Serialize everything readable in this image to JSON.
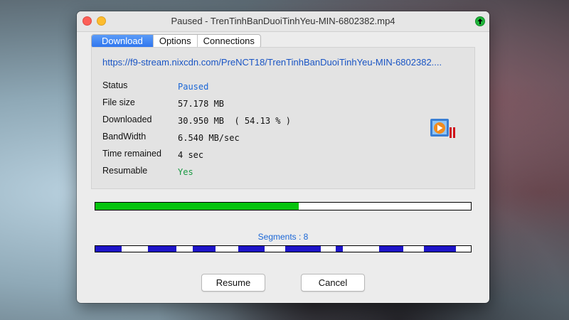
{
  "window": {
    "title": "Paused -  TrenTinhBanDuoiTinhYeu-MIN-6802382.mp4"
  },
  "tabs": [
    "Download",
    "Options",
    "Connections"
  ],
  "url": "https://f9-stream.nixcdn.com/PreNCT18/TrenTinhBanDuoiTinhYeu-MIN-6802382....",
  "info": {
    "status_label": "Status",
    "status_value": "Paused",
    "filesize_label": "File size",
    "filesize_value": "57.178 MB",
    "downloaded_label": "Downloaded",
    "downloaded_value": "30.950 MB  ( 54.13 % )",
    "bandwidth_label": "BandWidth",
    "bandwidth_value": "6.540 MB/sec",
    "time_label": "Time remained",
    "time_value": "4 sec",
    "resumable_label": "Resumable",
    "resumable_value": "Yes"
  },
  "progress": {
    "fraction": 0.5413,
    "color": "#06c40e"
  },
  "segments": {
    "label": "Segments : 8",
    "color": "#1e14c8",
    "ranges": [
      [
        0.0,
        0.07
      ],
      [
        0.14,
        0.215
      ],
      [
        0.26,
        0.32
      ],
      [
        0.38,
        0.45
      ],
      [
        0.505,
        0.6
      ],
      [
        0.64,
        0.66
      ],
      [
        0.755,
        0.82
      ],
      [
        0.875,
        0.96
      ]
    ]
  },
  "buttons": {
    "resume": "Resume",
    "cancel": "Cancel"
  },
  "icons": {
    "media": "media-player-paused-icon",
    "arrow": "arrow-up-icon"
  }
}
